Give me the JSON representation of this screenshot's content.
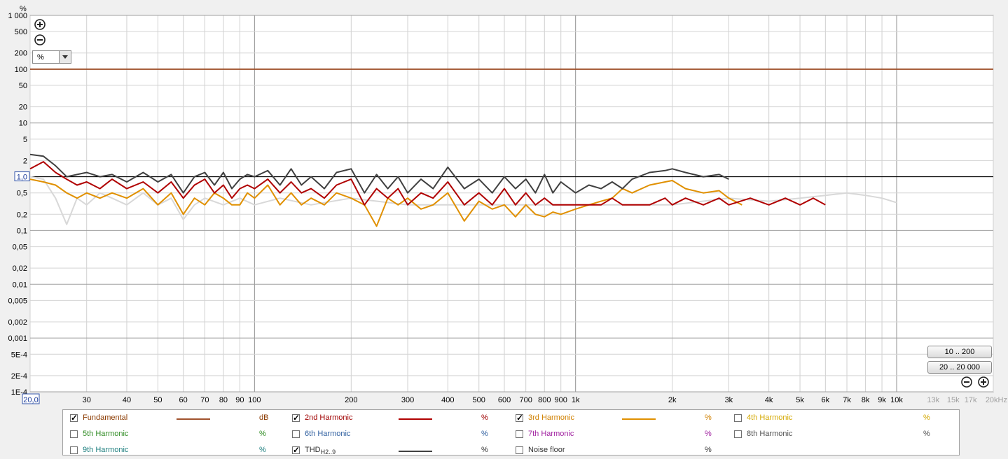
{
  "chart_data": {
    "type": "line",
    "ylabel": "%",
    "y_scale": "log",
    "x_scale": "log",
    "xlim": [
      20,
      20000
    ],
    "ylim": [
      0.0001,
      1000
    ],
    "grid": true,
    "y_ticks": [
      {
        "v": 1000,
        "t": "1 000"
      },
      {
        "v": 500,
        "t": "500"
      },
      {
        "v": 200,
        "t": "200"
      },
      {
        "v": 100,
        "t": "100"
      },
      {
        "v": 50,
        "t": "50"
      },
      {
        "v": 20,
        "t": "20"
      },
      {
        "v": 10,
        "t": "10"
      },
      {
        "v": 5,
        "t": "5"
      },
      {
        "v": 2,
        "t": "2"
      },
      {
        "v": 1,
        "t": "1,0"
      },
      {
        "v": 0.5,
        "t": "0,5"
      },
      {
        "v": 0.2,
        "t": "0,2"
      },
      {
        "v": 0.1,
        "t": "0,1"
      },
      {
        "v": 0.05,
        "t": "0,05"
      },
      {
        "v": 0.02,
        "t": "0,02"
      },
      {
        "v": 0.01,
        "t": "0,01"
      },
      {
        "v": 0.005,
        "t": "0,005"
      },
      {
        "v": 0.002,
        "t": "0,002"
      },
      {
        "v": 0.001,
        "t": "0,001"
      },
      {
        "v": 0.0005,
        "t": "5E-4"
      },
      {
        "v": 0.0002,
        "t": "2E-4"
      },
      {
        "v": 0.0001,
        "t": "1E-4"
      }
    ],
    "x_ticks": [
      {
        "v": 20,
        "t": "20,0"
      },
      {
        "v": 30,
        "t": "30"
      },
      {
        "v": 40,
        "t": "40"
      },
      {
        "v": 50,
        "t": "50"
      },
      {
        "v": 60,
        "t": "60"
      },
      {
        "v": 70,
        "t": "70"
      },
      {
        "v": 80,
        "t": "80"
      },
      {
        "v": 90,
        "t": "90"
      },
      {
        "v": 100,
        "t": "100"
      },
      {
        "v": 200,
        "t": "200"
      },
      {
        "v": 300,
        "t": "300"
      },
      {
        "v": 400,
        "t": "400"
      },
      {
        "v": 500,
        "t": "500"
      },
      {
        "v": 600,
        "t": "600"
      },
      {
        "v": 700,
        "t": "700"
      },
      {
        "v": 800,
        "t": "800"
      },
      {
        "v": 900,
        "t": "900"
      },
      {
        "v": 1000,
        "t": "1k"
      },
      {
        "v": 2000,
        "t": "2k"
      },
      {
        "v": 3000,
        "t": "3k"
      },
      {
        "v": 4000,
        "t": "4k"
      },
      {
        "v": 5000,
        "t": "5k"
      },
      {
        "v": 6000,
        "t": "6k"
      },
      {
        "v": 7000,
        "t": "7k"
      },
      {
        "v": 8000,
        "t": "8k"
      },
      {
        "v": 9000,
        "t": "9k"
      },
      {
        "v": 10000,
        "t": "10k"
      },
      {
        "v": 13000,
        "t": "13k"
      },
      {
        "v": 15000,
        "t": "15k"
      },
      {
        "v": 17000,
        "t": "17k"
      },
      {
        "v": 20000,
        "t": "20kHz"
      }
    ],
    "x_dim_from": 10000,
    "reference_line": 1,
    "series": [
      {
        "name": "Fundamental",
        "color": "#a0522d",
        "x": [
          20,
          20000
        ],
        "y": [
          100,
          100
        ]
      },
      {
        "name": "THD H2..9",
        "color": "#404040",
        "x": [
          20,
          22,
          24,
          26,
          28,
          30,
          33,
          36,
          40,
          45,
          50,
          55,
          60,
          65,
          70,
          75,
          80,
          85,
          90,
          95,
          100,
          110,
          120,
          130,
          140,
          150,
          165,
          180,
          200,
          220,
          240,
          260,
          280,
          300,
          330,
          360,
          400,
          450,
          500,
          550,
          600,
          650,
          700,
          750,
          800,
          850,
          900,
          1000,
          1100,
          1200,
          1300,
          1400,
          1500,
          1700,
          1900,
          2000,
          2200,
          2500,
          2800,
          3000
        ],
        "y": [
          2.6,
          2.4,
          1.6,
          1.0,
          1.1,
          1.2,
          1.0,
          1.1,
          0.8,
          1.2,
          0.8,
          1.1,
          0.5,
          1.0,
          1.2,
          0.7,
          1.2,
          0.6,
          0.9,
          1.1,
          1.0,
          1.3,
          0.7,
          1.4,
          0.7,
          1.0,
          0.6,
          1.2,
          1.4,
          0.5,
          1.1,
          0.6,
          1.0,
          0.5,
          0.9,
          0.6,
          1.5,
          0.6,
          0.9,
          0.5,
          1.0,
          0.6,
          0.9,
          0.5,
          1.1,
          0.5,
          0.8,
          0.5,
          0.7,
          0.6,
          0.8,
          0.6,
          0.9,
          1.2,
          1.3,
          1.4,
          1.2,
          1.0,
          1.1,
          0.9
        ]
      },
      {
        "name": "2nd Harmonic",
        "color": "#b00000",
        "x": [
          20,
          22,
          24,
          26,
          28,
          30,
          33,
          36,
          40,
          45,
          50,
          55,
          60,
          65,
          70,
          75,
          80,
          85,
          90,
          95,
          100,
          110,
          120,
          130,
          140,
          150,
          165,
          180,
          200,
          220,
          240,
          260,
          280,
          300,
          330,
          360,
          400,
          450,
          500,
          550,
          600,
          650,
          700,
          750,
          800,
          850,
          900,
          1000,
          1100,
          1200,
          1300,
          1400,
          1500,
          1700,
          1900,
          2000,
          2200,
          2500,
          2800,
          3000,
          3500,
          4000,
          4500,
          5000,
          5500,
          6000
        ],
        "y": [
          1.4,
          1.9,
          1.2,
          0.9,
          0.7,
          0.8,
          0.6,
          0.9,
          0.6,
          0.8,
          0.5,
          0.8,
          0.4,
          0.7,
          0.9,
          0.5,
          0.7,
          0.4,
          0.6,
          0.7,
          0.6,
          0.9,
          0.5,
          0.8,
          0.5,
          0.6,
          0.4,
          0.7,
          0.9,
          0.3,
          0.6,
          0.4,
          0.6,
          0.3,
          0.5,
          0.4,
          0.8,
          0.3,
          0.5,
          0.3,
          0.6,
          0.3,
          0.5,
          0.3,
          0.4,
          0.3,
          0.3,
          0.3,
          0.3,
          0.3,
          0.4,
          0.3,
          0.3,
          0.3,
          0.4,
          0.3,
          0.4,
          0.3,
          0.4,
          0.3,
          0.4,
          0.3,
          0.4,
          0.3,
          0.4,
          0.3
        ]
      },
      {
        "name": "3rd Harmonic",
        "color": "#e09000",
        "x": [
          20,
          22,
          24,
          26,
          28,
          30,
          33,
          36,
          40,
          45,
          50,
          55,
          60,
          65,
          70,
          75,
          80,
          85,
          90,
          95,
          100,
          110,
          120,
          130,
          140,
          150,
          165,
          180,
          200,
          220,
          240,
          260,
          280,
          300,
          330,
          360,
          400,
          450,
          500,
          550,
          600,
          650,
          700,
          750,
          800,
          850,
          900,
          1000,
          1100,
          1200,
          1300,
          1400,
          1500,
          1700,
          1900,
          2000,
          2200,
          2500,
          2800,
          3000,
          3300
        ],
        "y": [
          0.9,
          0.8,
          0.7,
          0.5,
          0.4,
          0.5,
          0.4,
          0.5,
          0.4,
          0.6,
          0.3,
          0.5,
          0.2,
          0.4,
          0.3,
          0.5,
          0.4,
          0.3,
          0.3,
          0.5,
          0.4,
          0.7,
          0.3,
          0.5,
          0.3,
          0.4,
          0.3,
          0.5,
          0.4,
          0.3,
          0.12,
          0.4,
          0.3,
          0.4,
          0.25,
          0.3,
          0.5,
          0.15,
          0.35,
          0.25,
          0.3,
          0.18,
          0.3,
          0.2,
          0.18,
          0.22,
          0.2,
          0.25,
          0.3,
          0.35,
          0.4,
          0.6,
          0.5,
          0.7,
          0.8,
          0.85,
          0.6,
          0.5,
          0.55,
          0.4,
          0.3
        ]
      },
      {
        "name": "Noise floor",
        "color": "#d8d8d8",
        "x": [
          20,
          22,
          24,
          26,
          28,
          30,
          33,
          36,
          40,
          45,
          50,
          55,
          60,
          65,
          70,
          80,
          90,
          100,
          120,
          150,
          200,
          300,
          400,
          600,
          800,
          1000,
          1500,
          2000,
          3000,
          4000,
          5000,
          6000,
          7000,
          8000,
          9000,
          10000
        ],
        "y": [
          1.0,
          0.9,
          0.4,
          0.13,
          0.4,
          0.3,
          0.5,
          0.4,
          0.3,
          0.5,
          0.3,
          0.4,
          0.16,
          0.3,
          0.4,
          0.3,
          0.4,
          0.3,
          0.4,
          0.3,
          0.4,
          0.3,
          0.3,
          0.3,
          0.3,
          0.3,
          0.3,
          0.3,
          0.4,
          0.35,
          0.4,
          0.45,
          0.5,
          0.45,
          0.4,
          0.33
        ]
      }
    ]
  },
  "axes": {
    "y_unit": "%"
  },
  "controls": {
    "unit_select_value": "%",
    "range_btn_1": "10 .. 200",
    "range_btn_2": "20 .. 20 000"
  },
  "legend": [
    {
      "label": "Fundamental",
      "checked": true,
      "color": "#a0522d",
      "unit": "dB",
      "line": true,
      "labelColor": "#8b3a00"
    },
    {
      "label": "2nd Harmonic",
      "checked": true,
      "color": "#b00000",
      "unit": "%",
      "line": true,
      "labelColor": "#a00000"
    },
    {
      "label": "3rd Harmonic",
      "checked": true,
      "color": "#e09000",
      "unit": "%",
      "line": true,
      "labelColor": "#d08000"
    },
    {
      "label": "4th Harmonic",
      "checked": false,
      "color": "#e0b000",
      "unit": "%",
      "line": false,
      "labelColor": "#d4a800"
    },
    {
      "label": "5th Harmonic",
      "checked": false,
      "color": "#2e8b22",
      "unit": "%",
      "line": false,
      "labelColor": "#2e8b22"
    },
    {
      "label": "6th Harmonic",
      "checked": false,
      "color": "#3060a0",
      "unit": "%",
      "line": false,
      "labelColor": "#3060a0"
    },
    {
      "label": "7th Harmonic",
      "checked": false,
      "color": "#a020a0",
      "unit": "%",
      "line": false,
      "labelColor": "#a020a0"
    },
    {
      "label": "8th Harmonic",
      "checked": false,
      "color": "#606060",
      "unit": "%",
      "line": false,
      "labelColor": "#505050"
    },
    {
      "label": "9th Harmonic",
      "checked": false,
      "color": "#208080",
      "unit": "%",
      "line": false,
      "labelColor": "#208080"
    },
    {
      "label": "THD",
      "sub": "H2..9",
      "checked": true,
      "color": "#404040",
      "unit": "%",
      "line": true,
      "labelColor": "#333333"
    },
    {
      "label": "Noise floor",
      "checked": false,
      "color": "#555555",
      "unit": "%",
      "line": false,
      "labelColor": "#333333"
    }
  ]
}
